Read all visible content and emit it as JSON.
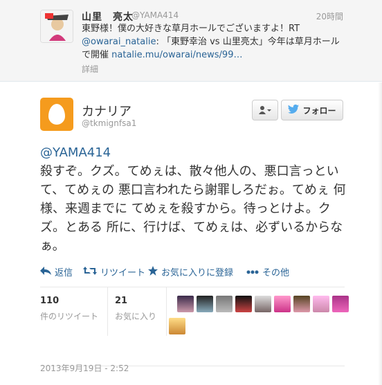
{
  "context_tweet": {
    "name": "山里　亮太",
    "handle": "@YAMA414",
    "time": "20時間",
    "text_1": "東野様！僕の大好きな草月ホールでございますよ！RT ",
    "mention": "@owarai_natalie",
    "text_2": ": 「東野幸治 vs 山里亮太」今年は草月ホールで開催 ",
    "link": "natalie.mu/owarai/news/99…",
    "detail": "詳細"
  },
  "tweet": {
    "name": "カナリア",
    "handle": "@tkmignfsa1",
    "follow_label": "フォロー",
    "mention": "@YAMA414",
    "text": "殺すぞ。クズ。てめぇは、散々他人の、悪口言っといて、てめぇの 悪口言われたら謝罪しろだぉ。てめぇ 何様、来週までに てめぇを殺すから。待っとけよ。クズ。とある 所に、行けば、てめぇは、必ずいるからなぁ。",
    "actions": {
      "reply": "返信",
      "retweet": "リツイート",
      "favorite": "お気に入りに登録",
      "more": "その他"
    },
    "stats": {
      "retweets_count": "110",
      "retweets_label": "件のリツイート",
      "favorites_count": "21",
      "favorites_label": "お気に入り"
    },
    "timestamp": "2013年9月19日 - 2:52"
  },
  "colors": {
    "link": "#2a6496",
    "egg": "#f59b1d",
    "twitter_blue": "#55acee"
  }
}
